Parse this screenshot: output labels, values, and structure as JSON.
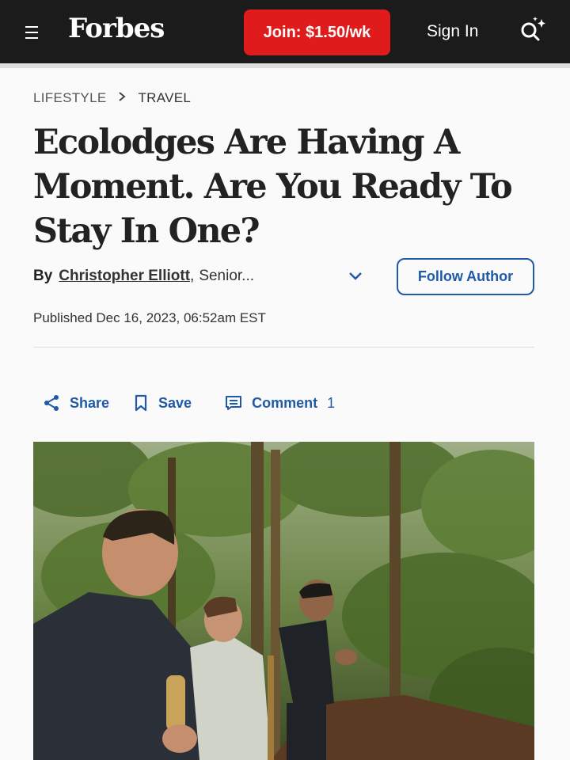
{
  "header": {
    "logo": "Forbes",
    "join_label": "Join: $1.50/wk",
    "signin_label": "Sign In"
  },
  "breadcrumb": {
    "section": "LIFESTYLE",
    "subsection": "TRAVEL"
  },
  "article": {
    "title": "Ecolodges Are Having A Moment. Are You Ready To Stay In One?",
    "by_label": "By",
    "author": "Christopher Elliott",
    "author_role": "Senior...",
    "follow_label": "Follow Author",
    "published": "Published Dec 16, 2023, 06:52am EST"
  },
  "actions": {
    "share_label": "Share",
    "save_label": "Save",
    "comment_label": "Comment",
    "comment_count": "1"
  },
  "colors": {
    "header_bg": "#1b1b1b",
    "join_red": "#e01b1b",
    "link_blue": "#1e5aa8"
  },
  "icons": [
    "menu-icon",
    "search-sparkle-icon",
    "chevron-right-icon",
    "chevron-down-icon",
    "share-icon",
    "bookmark-icon",
    "comment-icon"
  ]
}
